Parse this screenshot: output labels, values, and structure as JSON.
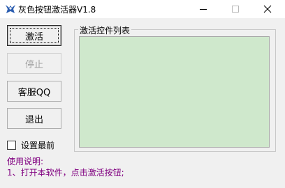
{
  "window": {
    "title": "灰色按钮激活器V1.8",
    "icon": "app-bird-icon",
    "controls": [
      "minimize-icon",
      "maximize-icon",
      "close-icon"
    ]
  },
  "buttons": {
    "activate": "激活",
    "stop": "停止",
    "support_qq": "客服QQ",
    "exit": "退出"
  },
  "options": {
    "topmost_label": "设置最前",
    "topmost_checked": false
  },
  "list_group": {
    "label": "激活控件列表",
    "items": []
  },
  "instructions": {
    "heading": "使用说明:",
    "step1": "1、打开本软件，点击激活按钮;"
  },
  "colors": {
    "list_background": "#cfe8cc",
    "instructions_text": "#800080",
    "disabled_text": "#a0a0a0"
  }
}
